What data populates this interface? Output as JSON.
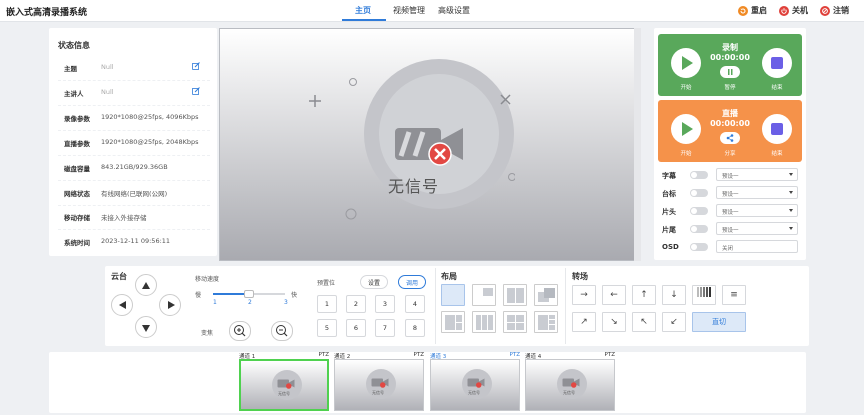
{
  "header": {
    "app_title": "嵌入式高清录播系统",
    "tabs": [
      {
        "label": "主页",
        "active": true
      },
      {
        "label": "视频管理",
        "active": false
      },
      {
        "label": "高级设置",
        "active": false
      }
    ],
    "actions": [
      {
        "label": "重启",
        "icon": "restart-icon",
        "color": "#f08a24"
      },
      {
        "label": "关机",
        "icon": "power-icon",
        "color": "#e0403a"
      },
      {
        "label": "注销",
        "icon": "logout-icon",
        "color": "#e0403a"
      }
    ]
  },
  "status": {
    "title": "状态信息",
    "rows": [
      {
        "label": "主题",
        "value": "Null",
        "editable": true
      },
      {
        "label": "主讲人",
        "value": "Null",
        "editable": true
      },
      {
        "label": "录像参数",
        "value": "1920*1080@25fps, 4096Kbps"
      },
      {
        "label": "直播参数",
        "value": "1920*1080@25fps, 2048Kbps"
      },
      {
        "label": "磁盘容量",
        "value": "843.21GB/929.36GB"
      },
      {
        "label": "网络状态",
        "value": "有线网络(已联网(公网)"
      },
      {
        "label": "移动存储",
        "value": "未接入外接存储"
      },
      {
        "label": "系统时间",
        "value": "2023-12-11 09:56:11"
      }
    ]
  },
  "preview": {
    "no_signal_text": "无信号"
  },
  "record": {
    "title": "录制",
    "time": "00:00:00",
    "start_label": "开始",
    "pause_label": "暂停",
    "stop_label": "结束",
    "color": "#59a85b"
  },
  "live": {
    "title": "直播",
    "time": "00:00:00",
    "start_label": "开始",
    "share_label": "分享",
    "stop_label": "结束",
    "color": "#f5924a"
  },
  "overlays": [
    {
      "label": "字幕",
      "value": "预设一",
      "type": "select"
    },
    {
      "label": "台标",
      "value": "预设一",
      "type": "select"
    },
    {
      "label": "片头",
      "value": "预设一",
      "type": "select"
    },
    {
      "label": "片尾",
      "value": "预设一",
      "type": "select"
    },
    {
      "label": "OSD",
      "value": "关闭",
      "type": "text"
    }
  ],
  "ptz": {
    "title": "云台",
    "speed_label": "移动速度",
    "slow_label": "慢",
    "fast_label": "快",
    "speed_marks": [
      "1",
      "2",
      "3"
    ],
    "speed_value": 2,
    "zoom_label": "变焦",
    "preset_label": "预置位",
    "set_label": "设置",
    "call_label": "调用",
    "presets": [
      "1",
      "2",
      "3",
      "4",
      "5",
      "6",
      "7",
      "8"
    ]
  },
  "layout": {
    "title": "布局"
  },
  "transition": {
    "title": "转场",
    "cut_label": "直切"
  },
  "channels": [
    {
      "name": "通道 1",
      "ptz": "PTZ",
      "selected": true,
      "no_signal": "无信号"
    },
    {
      "name": "通道 2",
      "ptz": "PTZ",
      "selected": false,
      "no_signal": "无信号"
    },
    {
      "name": "通道 3",
      "ptz": "PTZ",
      "selected": false,
      "no_signal": "无信号"
    },
    {
      "name": "通道 4",
      "ptz": "PTZ",
      "selected": false,
      "no_signal": "无信号"
    }
  ]
}
